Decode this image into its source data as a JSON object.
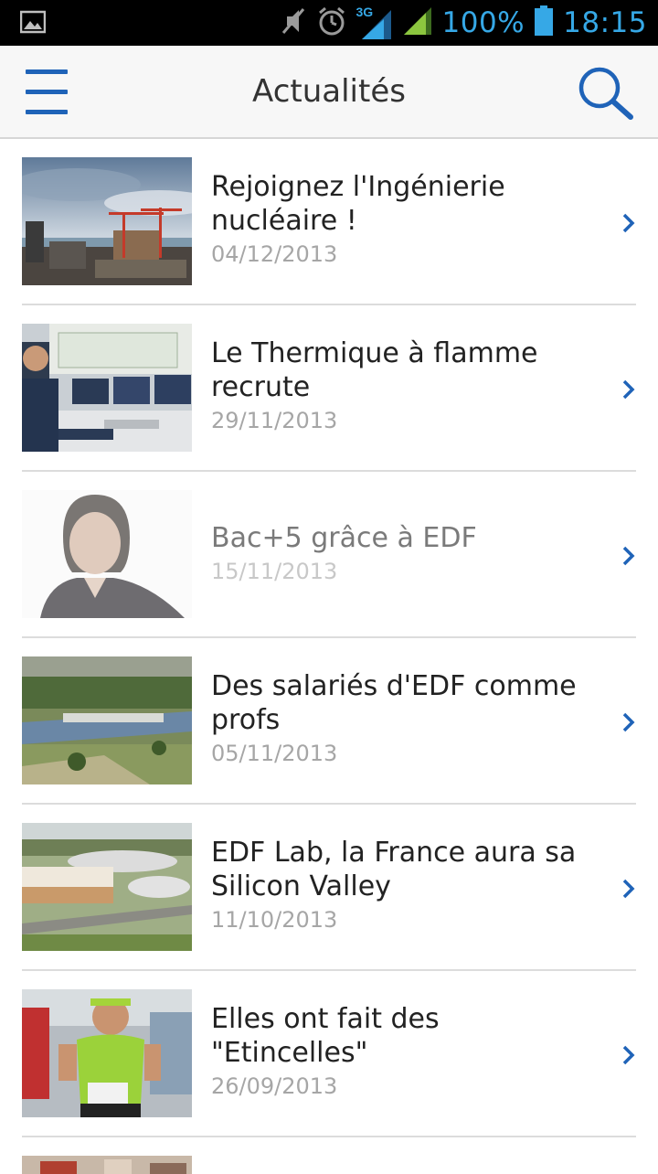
{
  "status_bar": {
    "network": "3G",
    "battery": "100%",
    "time": "18:15"
  },
  "appbar": {
    "title": "Actualités"
  },
  "items": [
    {
      "headline": "Rejoignez l'Ingénierie nucléaire !",
      "date": "04/12/2013"
    },
    {
      "headline": "Le Thermique à flamme recrute",
      "date": "29/11/2013"
    },
    {
      "headline": "Bac+5 grâce à EDF",
      "date": "15/11/2013"
    },
    {
      "headline": "Des salariés d'EDF comme profs",
      "date": "05/11/2013"
    },
    {
      "headline": "EDF Lab, la France aura sa Silicon Valley",
      "date": "11/10/2013"
    },
    {
      "headline": "Elles ont fait des \"Etincelles\"",
      "date": "26/09/2013"
    }
  ],
  "colors": {
    "accent": "#1f63b8",
    "status_icons": "#36a8e6",
    "signal_green": "#8cc63f"
  }
}
